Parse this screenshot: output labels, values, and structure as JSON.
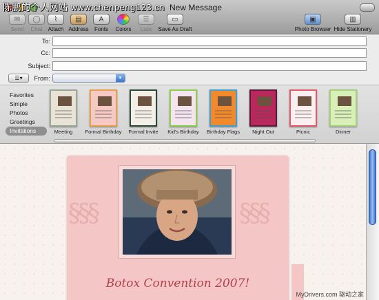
{
  "window": {
    "title": "New Message",
    "watermark": "陈鹏的个人网站 www.chenpeng123.cn"
  },
  "toolbar": {
    "items": [
      {
        "label": "Send",
        "icon": "send-icon",
        "enabled": false
      },
      {
        "label": "Chat",
        "icon": "chat-icon",
        "enabled": false
      },
      {
        "label": "Attach",
        "icon": "paperclip-icon",
        "enabled": true
      },
      {
        "label": "Address",
        "icon": "address-book-icon",
        "enabled": true
      },
      {
        "label": "Fonts",
        "icon": "fonts-icon",
        "enabled": true
      },
      {
        "label": "Colors",
        "icon": "colors-icon",
        "enabled": true
      },
      {
        "label": "Lists",
        "icon": "list-icon",
        "enabled": false
      },
      {
        "label": "Save As Draft",
        "icon": "save-draft-icon",
        "enabled": true
      },
      {
        "label": "Photo Browser",
        "icon": "photo-browser-icon",
        "enabled": true
      },
      {
        "label": "Hide Stationery",
        "icon": "stationery-icon",
        "enabled": true
      }
    ]
  },
  "headers": {
    "to_label": "To:",
    "to_value": "",
    "cc_label": "Cc:",
    "cc_value": "",
    "subject_label": "Subject:",
    "subject_value": "",
    "from_label": "From:",
    "from_value": "",
    "account_button": "☰▾"
  },
  "stationery": {
    "categories": [
      "Favorites",
      "Simple",
      "Photos",
      "Greetings",
      "Invitations"
    ],
    "selected_category": "Invitations",
    "templates": [
      {
        "label": "Meeting",
        "color": "#e9e3d6",
        "border": "#9aa89a"
      },
      {
        "label": "Formal Birthday",
        "color": "#f6c9c4",
        "border": "#e7a14a"
      },
      {
        "label": "Formal Invite",
        "color": "#f4efe6",
        "border": "#2c4a3a"
      },
      {
        "label": "Kid's Birthday",
        "color": "#f3e4ef",
        "border": "#8bcf4a"
      },
      {
        "label": "Birthday Flags",
        "color": "#f28a2c",
        "border": "#3aa0d8"
      },
      {
        "label": "Night Out",
        "color": "#b8285a",
        "border": "#5a1a3a"
      },
      {
        "label": "Picnic",
        "color": "#fbeff0",
        "border": "#e45a6a"
      },
      {
        "label": "Dinner",
        "color": "#d9efb8",
        "border": "#a8d07a"
      }
    ]
  },
  "message": {
    "headline": "Botox Convention 2007!",
    "card_color": "#f4c7c6",
    "headline_color": "#b0424e"
  },
  "credit": "MyDrivers.com 驱动之家"
}
